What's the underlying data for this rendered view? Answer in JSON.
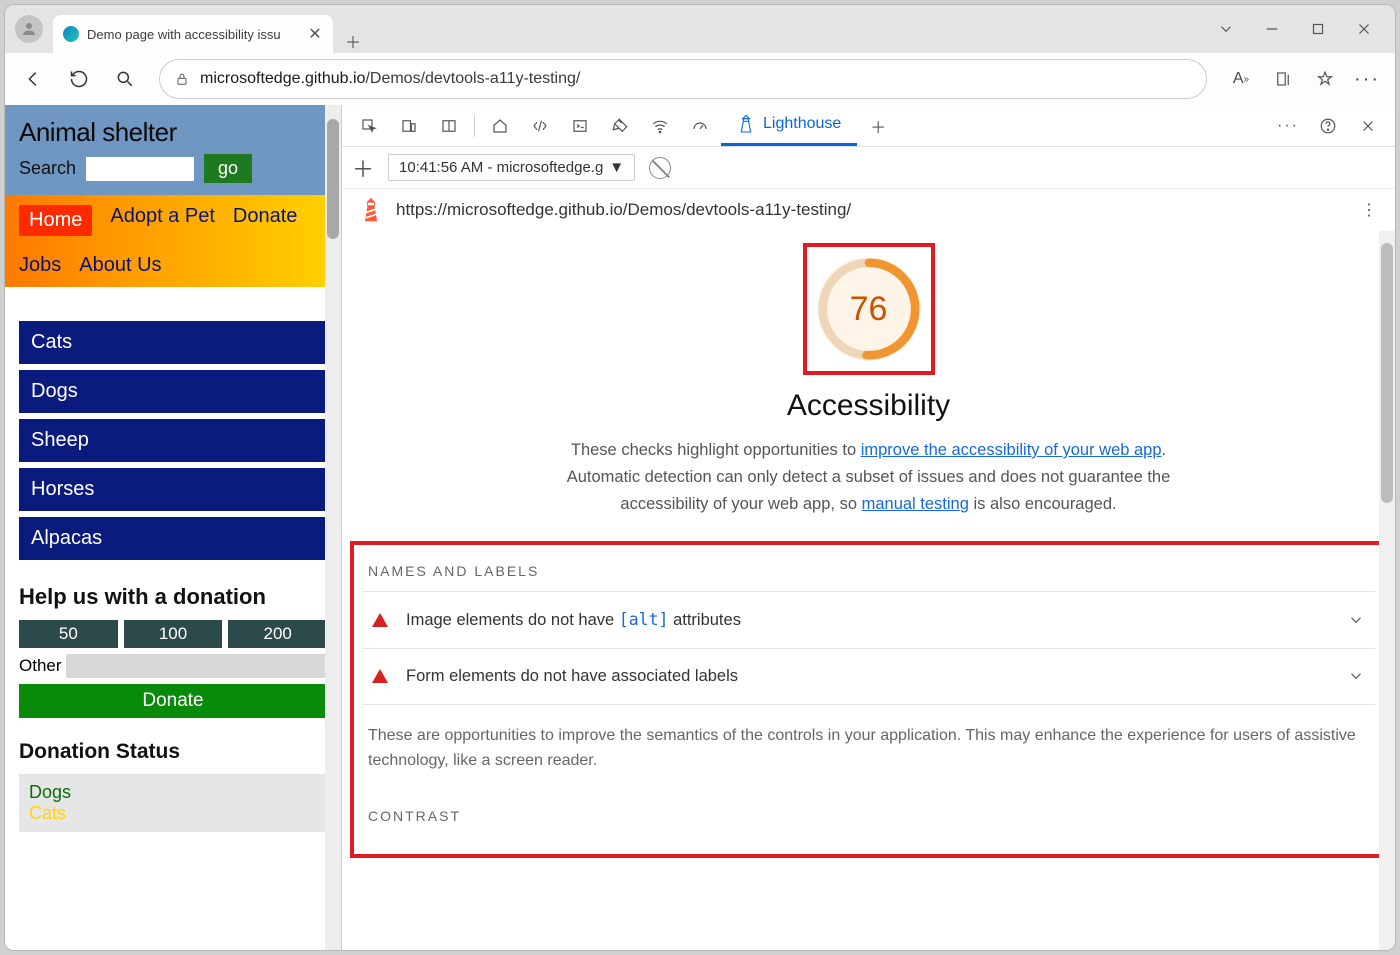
{
  "browser": {
    "tab_title": "Demo page with accessibility issu",
    "url_host": "microsoftedge.github.io",
    "url_path": "/Demos/devtools-a11y-testing/"
  },
  "site": {
    "title": "Animal shelter",
    "search_label": "Search",
    "go_label": "go",
    "nav": {
      "home": "Home",
      "adopt": "Adopt a Pet",
      "donate": "Donate",
      "jobs": "Jobs",
      "about": "About Us"
    },
    "categories": [
      "Cats",
      "Dogs",
      "Sheep",
      "Horses",
      "Alpacas"
    ],
    "donation": {
      "heading": "Help us with a donation",
      "amounts": [
        "50",
        "100",
        "200"
      ],
      "other_label": "Other",
      "donate_label": "Donate"
    },
    "status": {
      "heading": "Donation Status",
      "dogs": "Dogs",
      "cats": "Cats"
    }
  },
  "devtools": {
    "lighthouse_tab": "Lighthouse",
    "run_label": "10:41:56 AM - microsoftedge.g",
    "tested_url": "https://microsoftedge.github.io/Demos/devtools-a11y-testing/",
    "score": "76",
    "category": "Accessibility",
    "desc_pre": "These checks highlight opportunities to ",
    "desc_link1": "improve the accessibility of your web app",
    "desc_mid": ". Automatic detection can only detect a subset of issues and does not guarantee the accessibility of your web app, so ",
    "desc_link2": "manual testing",
    "desc_post": " is also encouraged.",
    "group1": "NAMES AND LABELS",
    "audit1_pre": "Image elements do not have ",
    "audit1_code": "[alt]",
    "audit1_post": " attributes",
    "audit2": "Form elements do not have associated labels",
    "group1_foot": "These are opportunities to improve the semantics of the controls in your application. This may enhance the experience for users of assistive technology, like a screen reader.",
    "group2": "CONTRAST"
  }
}
